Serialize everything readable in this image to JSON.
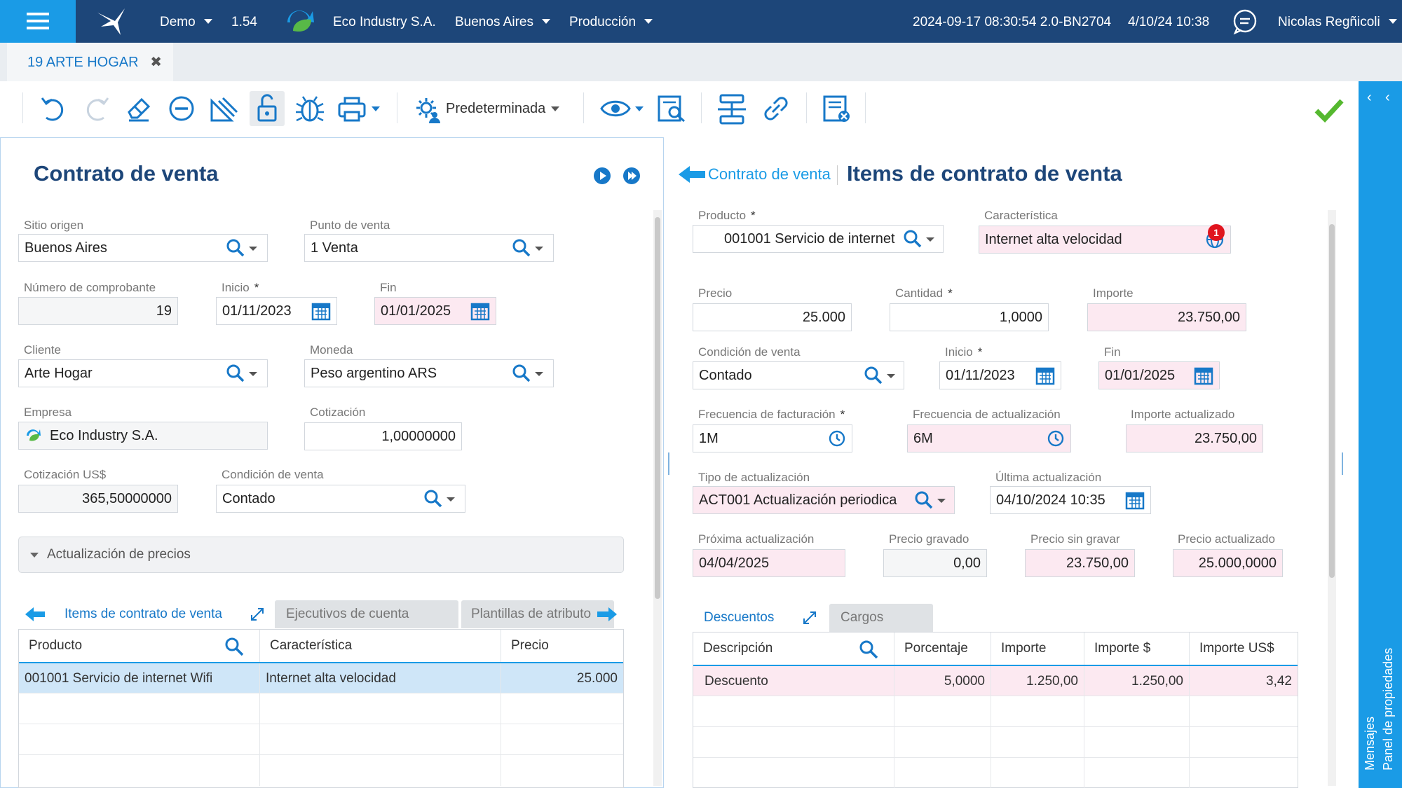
{
  "topbar": {
    "env": "Demo",
    "version": "1.54",
    "company": "Eco Industry S.A.",
    "site": "Buenos Aires",
    "module": "Producción",
    "build": "2024-09-17 08:30:54 2.0-BN2704",
    "datetime": "4/10/24 10:38",
    "user": "Nicolas Regñicoli"
  },
  "tab": {
    "label": "19 ARTE HOGAR",
    "close": "✖"
  },
  "toolbar": {
    "view_label": "Predeterminada"
  },
  "sidebar": {
    "messages": "Mensajes",
    "properties": "Panel de propiedades"
  },
  "left": {
    "title": "Contrato de venta",
    "fields": {
      "sitio_origen": {
        "label": "Sitio origen",
        "value": "Buenos Aires"
      },
      "punto_venta": {
        "label": "Punto de venta",
        "value": "1 Venta"
      },
      "numero": {
        "label": "Número de comprobante",
        "value": "19"
      },
      "inicio": {
        "label": "Inicio",
        "value": "01/11/2023"
      },
      "fin": {
        "label": "Fin",
        "value": "01/01/2025"
      },
      "cliente": {
        "label": "Cliente",
        "value": "Arte Hogar"
      },
      "moneda": {
        "label": "Moneda",
        "value": "Peso argentino ARS"
      },
      "empresa": {
        "label": "Empresa",
        "value": "Eco Industry S.A."
      },
      "cotizacion": {
        "label": "Cotización",
        "value": "1,00000000"
      },
      "cotizacion_usd": {
        "label": "Cotización US$",
        "value": "365,50000000"
      },
      "condicion": {
        "label": "Condición de venta",
        "value": "Contado"
      }
    },
    "section": "Actualización de precios",
    "tabs": [
      "Items de contrato de venta",
      "Ejecutivos de cuenta",
      "Plantillas de atributo"
    ],
    "grid": {
      "columns": [
        "Producto",
        "Característica",
        "Precio"
      ],
      "rows": [
        [
          "001001 Servicio de internet Wifi",
          "Internet alta velocidad",
          "25.000"
        ]
      ]
    }
  },
  "right": {
    "back": "Contrato de venta",
    "title": "Items de contrato de venta",
    "fields": {
      "producto": {
        "label": "Producto",
        "value": "001001 Servicio de internet"
      },
      "caracteristica": {
        "label": "Característica",
        "value": "Internet alta velocidad",
        "badge": "1"
      },
      "precio": {
        "label": "Precio",
        "value": "25.000"
      },
      "cantidad": {
        "label": "Cantidad",
        "value": "1,0000"
      },
      "importe": {
        "label": "Importe",
        "value": "23.750,00"
      },
      "condicion": {
        "label": "Condición de venta",
        "value": "Contado"
      },
      "inicio": {
        "label": "Inicio",
        "value": "01/11/2023"
      },
      "fin": {
        "label": "Fin",
        "value": "01/01/2025"
      },
      "freq_fact": {
        "label": "Frecuencia de facturación",
        "value": "1M"
      },
      "freq_act": {
        "label": "Frecuencia de actualización",
        "value": "6M"
      },
      "importe_act": {
        "label": "Importe actualizado",
        "value": "23.750,00"
      },
      "tipo_act": {
        "label": "Tipo de actualización",
        "value": "ACT001 Actualización periodica"
      },
      "ultima_act": {
        "label": "Última actualización",
        "value": "04/10/2024 10:35"
      },
      "proxima_act": {
        "label": "Próxima actualización",
        "value": "04/04/2025"
      },
      "precio_grav": {
        "label": "Precio gravado",
        "value": "0,00"
      },
      "precio_sin": {
        "label": "Precio sin gravar",
        "value": "23.750,00"
      },
      "precio_act": {
        "label": "Precio actualizado",
        "value": "25.000,0000"
      }
    },
    "tabs": [
      "Descuentos",
      "Cargos"
    ],
    "grid": {
      "columns": [
        "Descripción",
        "Porcentaje",
        "Importe",
        "Importe $",
        "Importe US$"
      ],
      "rows": [
        [
          "Descuento",
          "5,0000",
          "1.250,00",
          "1.250,00",
          "3,42"
        ]
      ]
    }
  },
  "colors": {
    "primary": "#1d4679",
    "accent": "#1a9be6",
    "pink": "#fce9f1",
    "ok": "#55b82f"
  }
}
